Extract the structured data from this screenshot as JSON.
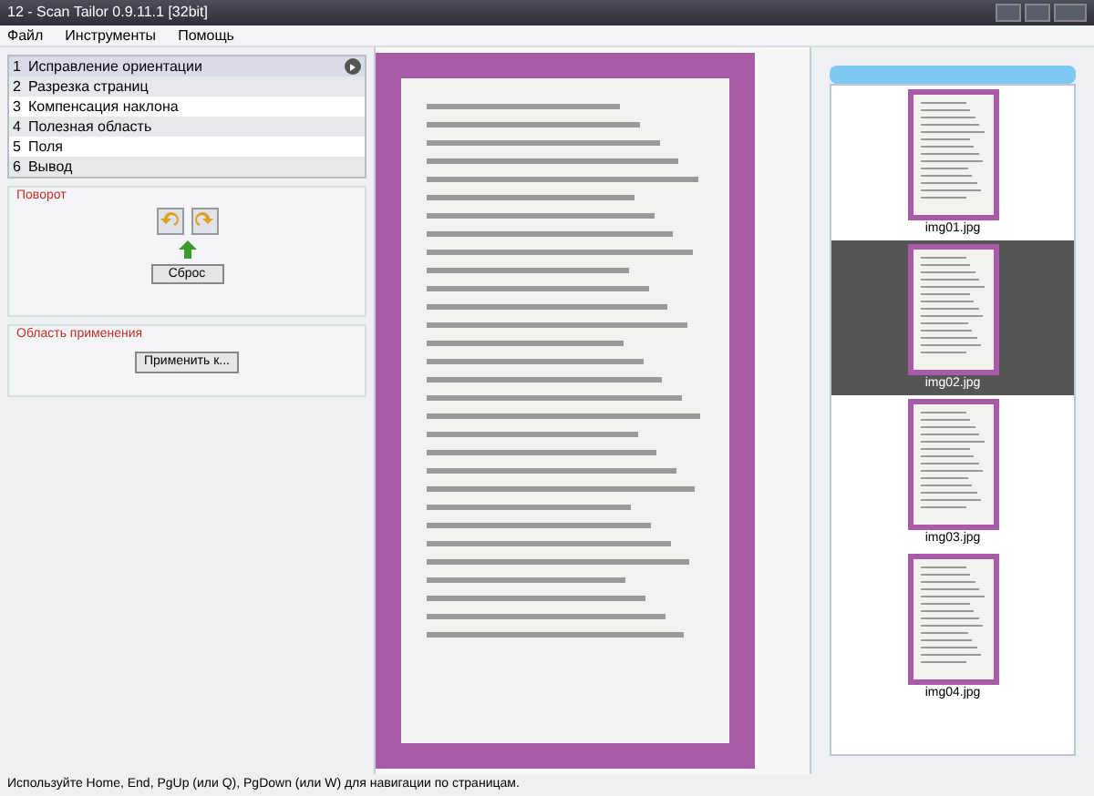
{
  "window": {
    "title": "12 - Scan Tailor 0.9.11.1 [32bit]"
  },
  "menu": [
    "Файл",
    "Инструменты",
    "Помощь"
  ],
  "steps": [
    {
      "number": "1",
      "label": "Исправление ориентации",
      "selected": true
    },
    {
      "number": "2",
      "label": "Разрезка страниц",
      "selected": false
    },
    {
      "number": "3",
      "label": "Компенсация наклона",
      "selected": false
    },
    {
      "number": "4",
      "label": "Полезная область",
      "selected": false
    },
    {
      "number": "5",
      "label": "Поля",
      "selected": false
    },
    {
      "number": "6",
      "label": "Вывод",
      "selected": false
    }
  ],
  "rotation_group": {
    "title": "Поворот",
    "reset_button": "Сброс"
  },
  "scope_group": {
    "title": "Область применения",
    "apply_button": "Применить к..."
  },
  "thumbnails": [
    {
      "name": "img01.jpg",
      "selected": false
    },
    {
      "name": "img02.jpg",
      "selected": true
    },
    {
      "name": "img03.jpg",
      "selected": false
    },
    {
      "name": "img04.jpg",
      "selected": false
    }
  ],
  "status_bar": "Используйте Home, End, PgUp (или Q), PgDown (или W) для навигации по страницам."
}
